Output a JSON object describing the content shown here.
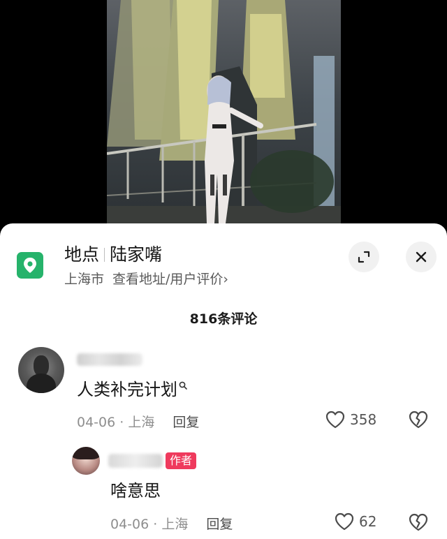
{
  "location": {
    "category": "地点",
    "name": "陆家嘴",
    "city": "上海市",
    "link_text": "查看地址/用户评价",
    "chevron": "›"
  },
  "icons": {
    "location": "map-pin-icon",
    "expand": "expand-icon",
    "close": "close-icon",
    "like": "heart-outline-icon",
    "dislike": "broken-heart-icon",
    "search_hint": "search-icon"
  },
  "comments_header": "816条评论",
  "comments": [
    {
      "text": "人类补完计划",
      "date": "04-06",
      "location": "上海",
      "reply_label": "回复",
      "likes": "358",
      "replies": [
        {
          "badge": "作者",
          "text": "啥意思",
          "date": "04-06",
          "location": "上海",
          "reply_label": "回复",
          "likes": "62"
        }
      ]
    }
  ],
  "colors": {
    "pin_green": "#26b36b",
    "author_badge": "#ef3a5d"
  }
}
